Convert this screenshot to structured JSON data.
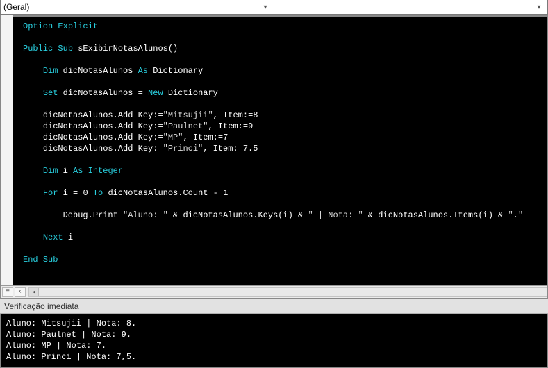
{
  "dropdown": {
    "object": "(Geral)",
    "proc": ""
  },
  "code_tokens": [
    [
      [
        "kw",
        "Option"
      ],
      [
        "sp",
        " "
      ],
      [
        "kw",
        "Explicit"
      ]
    ],
    [],
    [
      [
        "kw",
        "Public"
      ],
      [
        "sp",
        " "
      ],
      [
        "kw",
        "Sub"
      ],
      [
        "sp",
        " "
      ],
      [
        "id",
        "sExibirNotasAlunos"
      ],
      [
        "id",
        "()"
      ]
    ],
    [],
    [
      [
        "sp",
        "    "
      ],
      [
        "kw",
        "Dim"
      ],
      [
        "sp",
        " "
      ],
      [
        "id",
        "dicNotasAlunos"
      ],
      [
        "sp",
        " "
      ],
      [
        "kw",
        "As"
      ],
      [
        "sp",
        " "
      ],
      [
        "id",
        "Dictionary"
      ]
    ],
    [],
    [
      [
        "sp",
        "    "
      ],
      [
        "kw",
        "Set"
      ],
      [
        "sp",
        " "
      ],
      [
        "id",
        "dicNotasAlunos = "
      ],
      [
        "kw",
        "New"
      ],
      [
        "sp",
        " "
      ],
      [
        "id",
        "Dictionary"
      ]
    ],
    [],
    [
      [
        "sp",
        "    "
      ],
      [
        "id",
        "dicNotasAlunos.Add Key:="
      ],
      [
        "str",
        "\"Mitsujii\""
      ],
      [
        "id",
        ", Item:="
      ],
      [
        "num",
        "8"
      ]
    ],
    [
      [
        "sp",
        "    "
      ],
      [
        "id",
        "dicNotasAlunos.Add Key:="
      ],
      [
        "str",
        "\"Paulnet\""
      ],
      [
        "id",
        ", Item:="
      ],
      [
        "num",
        "9"
      ]
    ],
    [
      [
        "sp",
        "    "
      ],
      [
        "id",
        "dicNotasAlunos.Add Key:="
      ],
      [
        "str",
        "\"MP\""
      ],
      [
        "id",
        ", Item:="
      ],
      [
        "num",
        "7"
      ]
    ],
    [
      [
        "sp",
        "    "
      ],
      [
        "id",
        "dicNotasAlunos.Add Key:="
      ],
      [
        "str",
        "\"Princi\""
      ],
      [
        "id",
        ", Item:="
      ],
      [
        "num",
        "7.5"
      ]
    ],
    [],
    [
      [
        "sp",
        "    "
      ],
      [
        "kw",
        "Dim"
      ],
      [
        "sp",
        " "
      ],
      [
        "id",
        "i"
      ],
      [
        "sp",
        " "
      ],
      [
        "kw",
        "As"
      ],
      [
        "sp",
        " "
      ],
      [
        "kw",
        "Integer"
      ]
    ],
    [],
    [
      [
        "sp",
        "    "
      ],
      [
        "kw",
        "For"
      ],
      [
        "sp",
        " "
      ],
      [
        "id",
        "i = "
      ],
      [
        "num",
        "0"
      ],
      [
        "sp",
        " "
      ],
      [
        "kw",
        "To"
      ],
      [
        "sp",
        " "
      ],
      [
        "id",
        "dicNotasAlunos.Count - "
      ],
      [
        "num",
        "1"
      ]
    ],
    [],
    [
      [
        "sp",
        "        "
      ],
      [
        "id",
        "Debug.Print "
      ],
      [
        "str",
        "\"Aluno: \""
      ],
      [
        "id",
        " & dicNotasAlunos.Keys(i) & "
      ],
      [
        "str",
        "\" | Nota: \""
      ],
      [
        "id",
        " & dicNotasAlunos.Items(i) & "
      ],
      [
        "str",
        "\".\""
      ]
    ],
    [],
    [
      [
        "sp",
        "    "
      ],
      [
        "kw",
        "Next"
      ],
      [
        "sp",
        " "
      ],
      [
        "id",
        "i"
      ]
    ],
    [],
    [
      [
        "kw",
        "End"
      ],
      [
        "sp",
        " "
      ],
      [
        "kw",
        "Sub"
      ]
    ]
  ],
  "immediate": {
    "title": "Verificação imediata",
    "lines": [
      "Aluno: Mitsujii | Nota: 8.",
      "Aluno: Paulnet | Nota: 9.",
      "Aluno: MP | Nota: 7.",
      "Aluno: Princi | Nota: 7,5."
    ]
  },
  "toolstrip": {
    "btn1": "≡",
    "btn2": "‹"
  }
}
